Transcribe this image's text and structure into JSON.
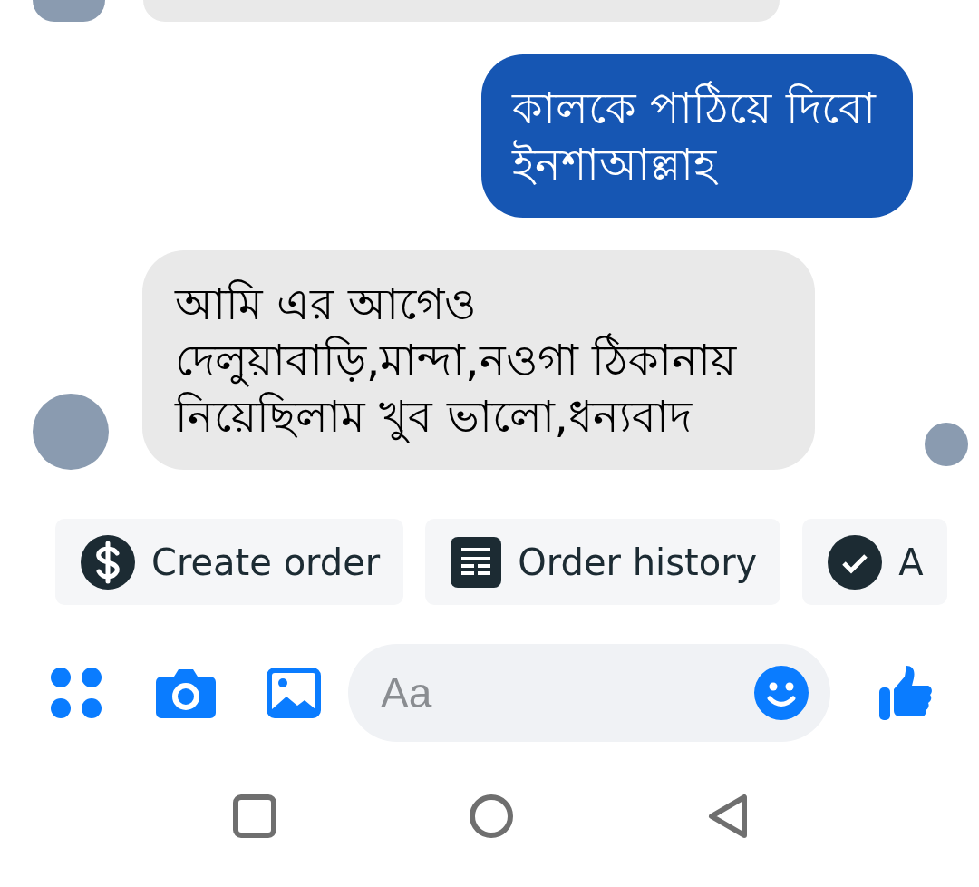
{
  "messages": [
    {
      "kind": "received_cut"
    },
    {
      "kind": "sent",
      "text": "কালকে পাঠিয়ে দিবো ইনশাআল্লাহ"
    },
    {
      "kind": "received",
      "text": "আমি এর আগেও দেলুয়াবাড়ি,মান্দা,নওগা ঠিকানায় নিয়েছিলাম খুব ভালো,ধন্যবাদ"
    }
  ],
  "quick_replies": [
    {
      "kind": "dollar",
      "label": "Create order"
    },
    {
      "kind": "list",
      "label": "Order history"
    },
    {
      "kind": "check",
      "label": "A"
    }
  ],
  "composer": {
    "placeholder": "Aa"
  }
}
